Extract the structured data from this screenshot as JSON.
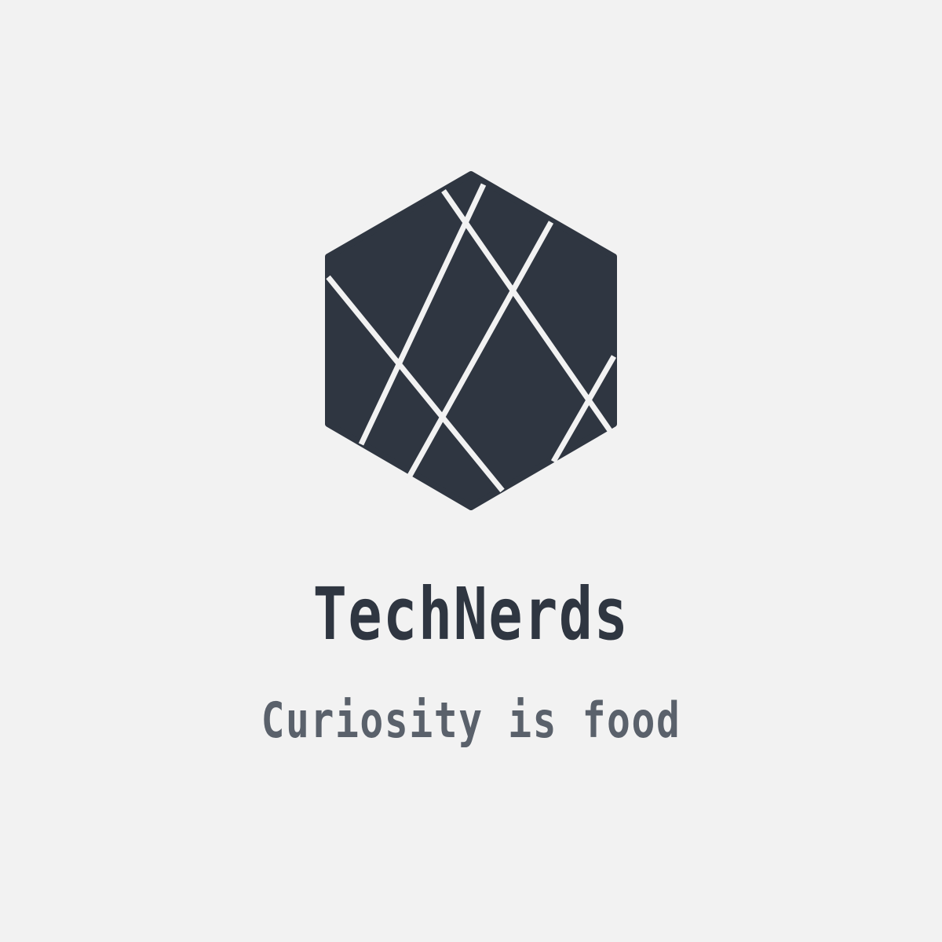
{
  "logo": {
    "icon": "faceted-hexagon-icon",
    "mark_color": "#2f3641",
    "line_color": "#f2f2f2"
  },
  "brand": {
    "name": "TechNerds",
    "name_color": "#2f3641",
    "tagline": "Curiosity is food",
    "tagline_color": "#5a616b"
  },
  "background_color": "#f2f2f2"
}
